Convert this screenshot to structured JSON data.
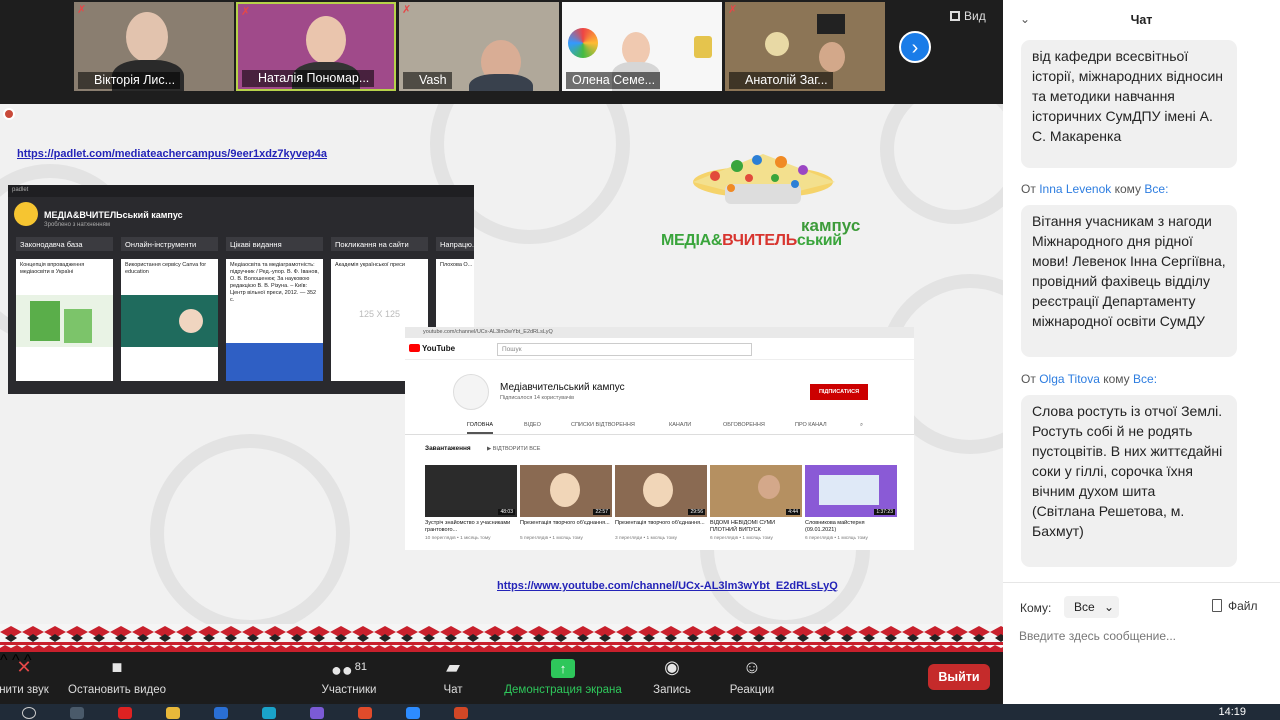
{
  "participants": [
    {
      "name": "Вікторія Лис...",
      "muted": true
    },
    {
      "name": "Наталія Пономар...",
      "muted": true
    },
    {
      "name": "Vash",
      "muted": true
    },
    {
      "name": "Олена Семе...",
      "muted": false
    },
    {
      "name": "Анатолій Заг...",
      "muted": true
    }
  ],
  "view_label": "Вид",
  "share": {
    "padlet_link": "https://padlet.com/mediateachercampus/9eer1xdz7kyvep4a",
    "youtube_link": "https://www.youtube.com/channel/UCx-AL3lm3wYbt_E2dRLsLyQ",
    "logo": {
      "kampus": "кампус",
      "media_a": "МЕДІА&",
      "media_b": "ВЧИТЕЛЬ",
      "media_c": "ський"
    },
    "padlet": {
      "title": "МЕДІА&ВЧИТЕЛЬський кампус",
      "subtitle": "Зроблено з натхненням",
      "columns": [
        {
          "head": "Законодавча база",
          "card": "Концепція впровадження медіаосвіти в Україні"
        },
        {
          "head": "Онлайн-інструменти",
          "card": "Використання сервісу Canva for education"
        },
        {
          "head": "Цікаві видання",
          "card": "Медіаосвіта та медіаграмотність: підручник / Ред.-упор. В. Ф. Іванов, О. В. Волошенюк; За науковою редакцією В. В. Різуна. – Київ: Центр вільної преси, 2012. — 352 с."
        },
        {
          "head": "Покликання на сайти",
          "card": "Академія української преси"
        },
        {
          "head": "Напрацю...",
          "card": "Плохова О..."
        }
      ],
      "placeholder_size": "125 X 125"
    },
    "youtube": {
      "search_placeholder": "Пошук",
      "channel": "Медіавчительський кампус",
      "subs": "Підписалося 14 користувачів",
      "subscribe": "ПІДПИСАТИСЯ",
      "tabs": [
        "ГОЛОВНА",
        "ВІДЕО",
        "СПИСКИ ВІДТВОРЕННЯ",
        "КАНАЛИ",
        "ОБГОВОРЕННЯ",
        "ПРО КАНАЛ"
      ],
      "uploads": "Завантаження",
      "play_all": "ВІДТВОРИТИ ВСЕ",
      "videos": [
        {
          "title": "Зустріч знайомство з учасниками грантового...",
          "meta": "10 переглядів • 1 місяць тому",
          "duration": "48:03"
        },
        {
          "title": "Презентація творчого об'єднання...",
          "meta": "5 переглядів • 1 місяць тому",
          "duration": "22:57"
        },
        {
          "title": "Презентація творчого об'єднання...",
          "meta": "3 перегляди • 1 місяць тому",
          "duration": "29:56"
        },
        {
          "title": "ВІДОМІ НЕВІДОМІ СУМИ ПЛОТНИЙ ВИПУСК",
          "meta": "6 переглядів • 1 місяць тому",
          "duration": "4:44"
        },
        {
          "title": "Словникова майстерня (09.01.2021)",
          "meta": "6 переглядів • 1 місяць тому",
          "duration": "1:37:23"
        }
      ]
    }
  },
  "toolbar": {
    "mute": "нити звук",
    "stop_video": "Остановить видео",
    "participants": "Участники",
    "participants_count": "81",
    "chat": "Чат",
    "share_screen": "Демонстрация экрана",
    "record": "Запись",
    "reactions": "Реакции",
    "leave": "Выйти"
  },
  "chat": {
    "title": "Чат",
    "messages": [
      {
        "text": "від кафедри всесвітньої історії, міжнародних відносин та методики навчання історичних СумДПУ імені А. С. Макаренка"
      },
      {
        "from_prefix": "От",
        "from": "Inna Levenok",
        "to_prefix": "кому",
        "to": "Все:",
        "text": "Вітання учасникам з нагоди Міжнародного дня рідної мови! Левенок Інна Сергіївна, провідний фахівець відділу реєстрації Департаменту міжнародної освіти СумДУ"
      },
      {
        "from_prefix": "От",
        "from": "Olga Titova",
        "to_prefix": "кому",
        "to": "Все:",
        "text": "Слова ростуть із отчої Землі. Ростуть собі й не родять пустоцвітів. В них життєдайні соки у гіллі, сорочка їхня вічним духом шита\n(Світлана Решетова, м. Бахмут)"
      }
    ],
    "to_label": "Кому:",
    "to_value": "Все",
    "file_label": "Файл",
    "input_placeholder": "Введите здесь сообщение..."
  },
  "taskbar": {
    "clock": "14:19"
  }
}
